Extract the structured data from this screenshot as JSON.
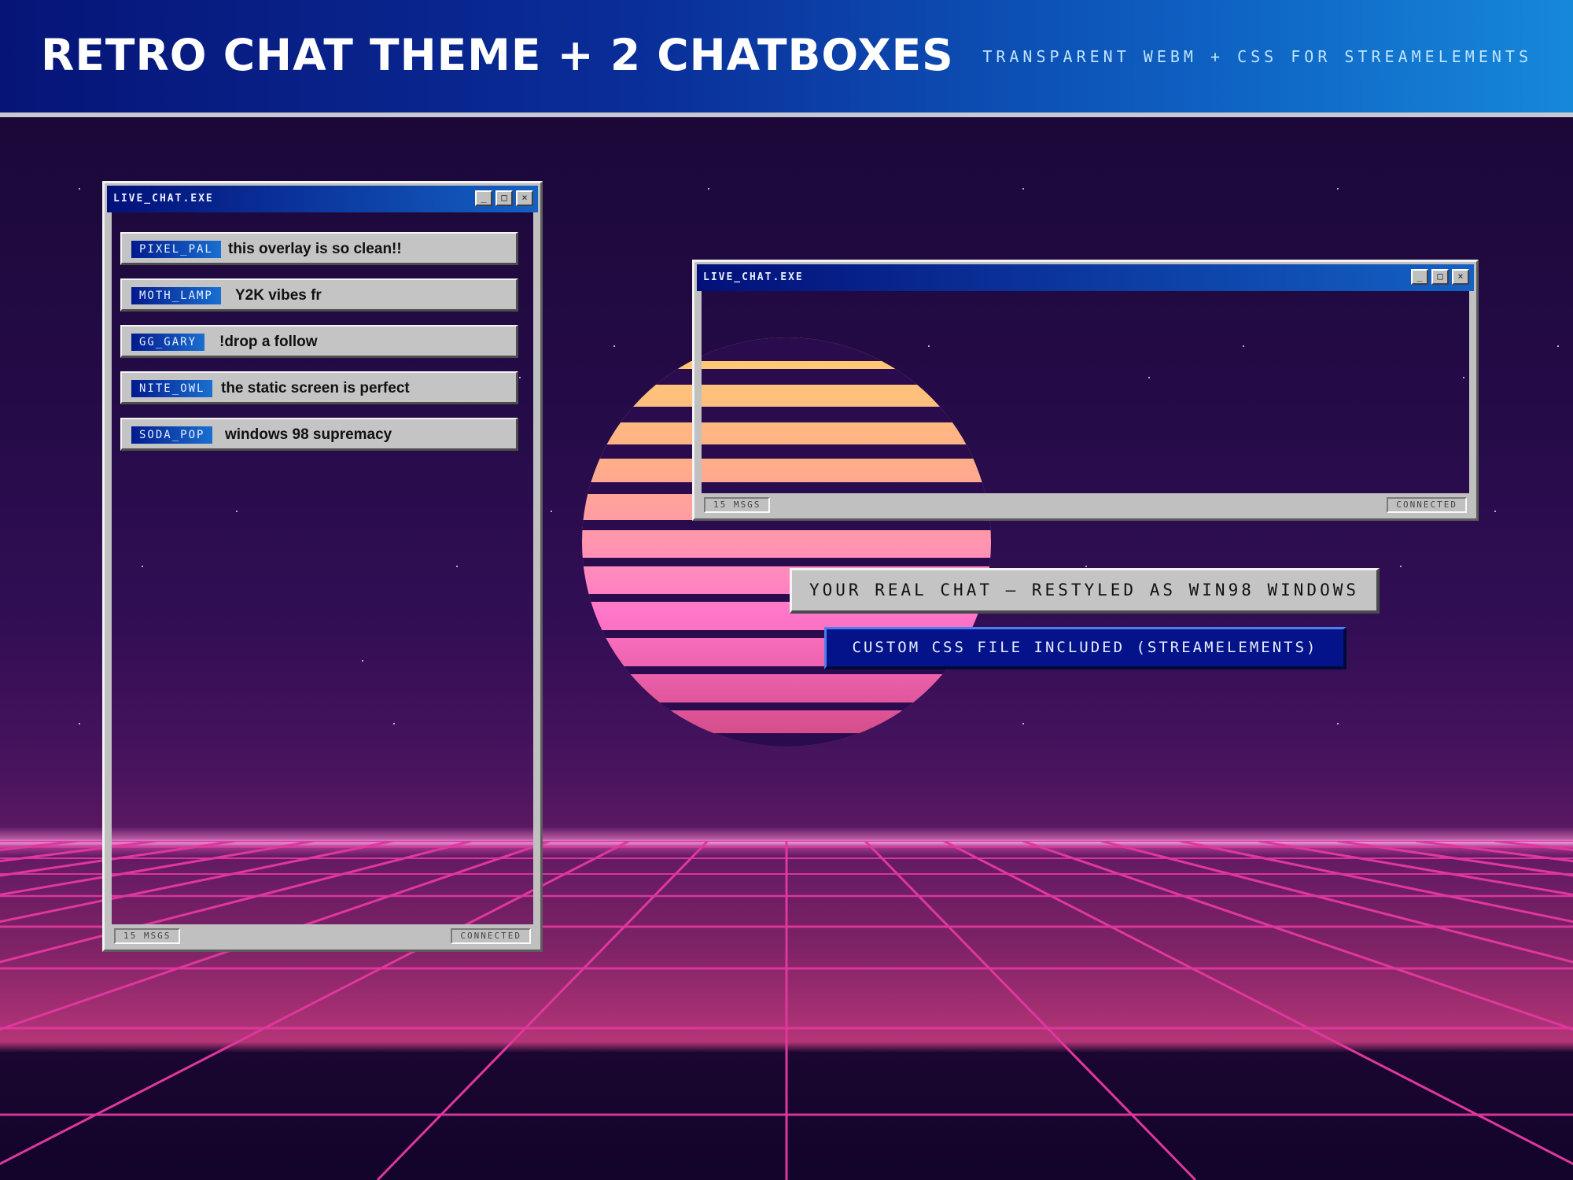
{
  "banner": {
    "title": "RETRO CHAT THEME + 2 CHATBOXES",
    "subtitle": "TRANSPARENT WEBM + CSS FOR STREAMELEMENTS"
  },
  "window_left": {
    "title": "LIVE_CHAT.EXE",
    "minimize_label": "_",
    "maximize_label": "□",
    "close_label": "×",
    "messages": [
      {
        "user": "PIXEL_PAL",
        "text": "this overlay is so clean!!"
      },
      {
        "user": "MOTH_LAMP",
        "text": "Y2K vibes fr"
      },
      {
        "user": "GG_GARY",
        "text": "!drop a follow"
      },
      {
        "user": "NITE_OWL",
        "text": "the static screen is perfect"
      },
      {
        "user": "SODA_POP",
        "text": "windows 98 supremacy"
      }
    ],
    "status_left": "15 MSGS",
    "status_right": "CONNECTED"
  },
  "window_right": {
    "title": "LIVE_CHAT.EXE",
    "minimize_label": "_",
    "maximize_label": "□",
    "close_label": "×",
    "status_left": "15 MSGS",
    "status_right": "CONNECTED"
  },
  "callouts": {
    "primary": "YOUR REAL CHAT — RESTYLED AS WIN98 WINDOWS",
    "secondary": "CUSTOM CSS FILE INCLUDED (STREAMELEMENTS)"
  },
  "colors": {
    "banner_start": "#061477",
    "banner_end": "#1688da",
    "grid_line": "#e0379e",
    "sun_top": "#ffd072",
    "sun_bottom": "#cf4b86",
    "window_gray": "#c0c0c0",
    "titlebar_blue": "#03107a"
  }
}
